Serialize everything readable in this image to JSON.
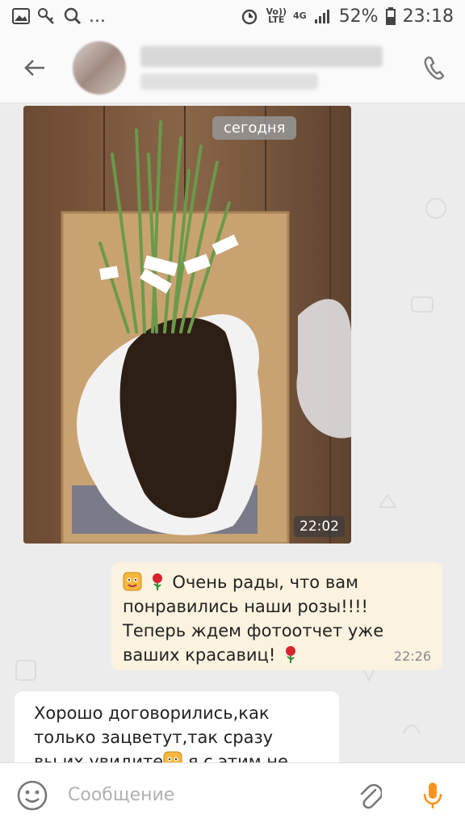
{
  "status_bar": {
    "volte": "Vo))",
    "lte": "LTE",
    "network": "4G",
    "battery": "52%",
    "time": "23:18",
    "dots": "..."
  },
  "chat": {
    "date_chip": "сегодня",
    "photo_time": "22:02",
    "outgoing": {
      "text": "Очень рады, что вам понравились наши розы!!!!Теперь ждем фотоотчет уже ваших красавиц!",
      "time": "22:26"
    },
    "incoming": {
      "text_line1": "Хорошо договорились,как",
      "text_line2": "только зацветут,так сразу",
      "text_line3a": "вы их увидите",
      "text_line3b": " я с этим не"
    }
  },
  "input": {
    "placeholder": "Сообщение"
  },
  "colors": {
    "accent": "#f7931e",
    "outgoing_bubble": "#fbf2df",
    "incoming_bubble": "#ffffff",
    "background": "#ececec"
  },
  "icons": [
    "gallery-icon",
    "key-icon",
    "search-icon",
    "alarm-icon",
    "signal-icon",
    "battery-icon",
    "back-arrow-icon",
    "phone-icon",
    "smiley-emoji-icon",
    "rose-emoji-icon",
    "emoji-icon",
    "attach-icon",
    "mic-icon"
  ]
}
